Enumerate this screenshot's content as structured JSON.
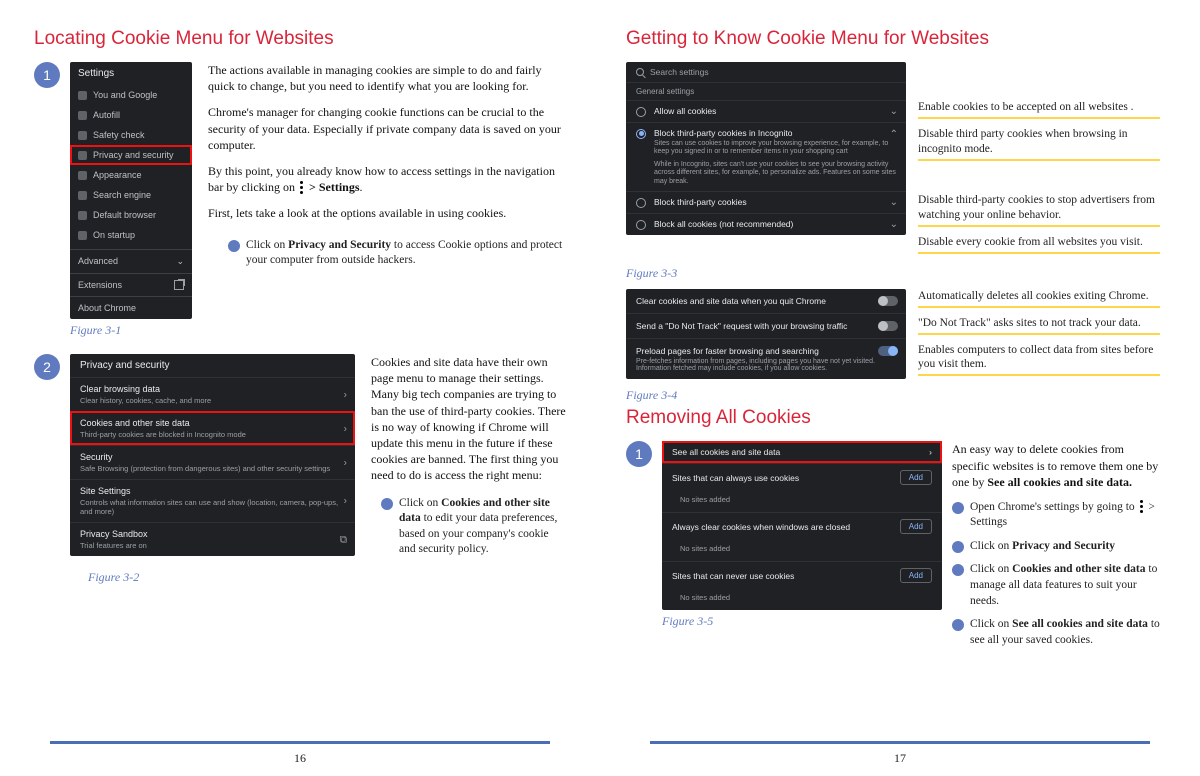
{
  "left": {
    "title": "Locating Cookie Menu for Websites",
    "para1": "The actions available in managing cookies are simple to do and fairly quick to change, but you need to identify what you are looking for.",
    "para2": "Chrome's manager for changing cookie functions can be crucial to the security of your data. Especially if private company data is saved on your computer.",
    "para3a": "By this point, you already know how to access settings in the navigation bar by clicking on",
    "para3b": "> Settings",
    "para4": "First, lets take a look at the options available in using cookies.",
    "bullet1_a": "Click on ",
    "bullet1_b": "Privacy and Security",
    "bullet1_c": " to access Cookie options and protect your computer from outside hackers.",
    "fig31": "Figure 3-1",
    "shot31": {
      "header": "Settings",
      "items": [
        "You and Google",
        "Autofill",
        "Safety check",
        "Privacy and security",
        "Appearance",
        "Search engine",
        "Default browser",
        "On startup"
      ],
      "advanced": "Advanced",
      "extensions": "Extensions",
      "about": "About Chrome"
    },
    "para5": "Cookies and site data have their own page menu to manage their settings. Many big tech companies are trying to ban the use of third-party cookies. There is no way of knowing if Chrome will update this menu in the future if these cookies are banned. The first thing you need to do is access the right menu:",
    "bullet2_a": "Click on ",
    "bullet2_b": "Cookies and other site data",
    "bullet2_c": " to edit your data preferences, based on your company's cookie and security policy.",
    "fig32": "Figure 3-2",
    "shot32": {
      "header": "Privacy and security",
      "opts": [
        {
          "t": "Clear browsing data",
          "s": "Clear history, cookies, cache, and more"
        },
        {
          "t": "Cookies and other site data",
          "s": "Third-party cookies are blocked in Incognito mode"
        },
        {
          "t": "Security",
          "s": "Safe Browsing (protection from dangerous sites) and other security settings"
        },
        {
          "t": "Site Settings",
          "s": "Controls what information sites can use and show (location, camera, pop-ups, and more)"
        },
        {
          "t": "Privacy Sandbox",
          "s": "Trial features are on"
        }
      ]
    },
    "pagenum": "16"
  },
  "right": {
    "title1": "Getting to Know Cookie Menu for Websites",
    "shot33": {
      "search": "Search settings",
      "gs": "General settings",
      "rows": [
        {
          "t": "Allow all cookies"
        },
        {
          "t": "Block third-party cookies in Incognito",
          "s1": "Sites can use cookies to improve your browsing experience, for example, to keep you signed in or to remember items in your shopping cart",
          "s2": "While in Incognito, sites can't use your cookies to see your browsing activity across different sites, for example, to personalize ads. Features on some sites may break."
        },
        {
          "t": "Block third-party cookies"
        },
        {
          "t": "Block all cookies (not recommended)"
        }
      ]
    },
    "annot33": [
      "Enable cookies to be accepted on all websites .",
      "Disable third party cookies when browsing in incognito mode.",
      "Disable third-party cookies to stop advertisers from watching your online behavior.",
      "Disable every cookie from all websites you visit."
    ],
    "fig33": "Figure 3-3",
    "shot34": {
      "rows": [
        {
          "t": "Clear cookies and site data when you quit Chrome",
          "on": false
        },
        {
          "t": "Send a \"Do Not Track\" request with your browsing traffic",
          "on": false
        },
        {
          "t": "Preload pages for faster browsing and searching",
          "s": "Pre-fetches information from pages, including pages you have not yet visited. Information fetched may include cookies, if you allow cookies.",
          "on": true
        }
      ]
    },
    "annot34": [
      "Automatically deletes all cookies exiting Chrome.",
      "\"Do Not Track\" asks sites to not track your data.",
      "Enables computers to collect data from sites before you visit them."
    ],
    "fig34": "Figure 3-4",
    "title2": "Removing All Cookies",
    "intro_a": "An easy way to delete cookies from specific websites is to remove them one by one by ",
    "intro_b": "See all cookies and site data.",
    "steps": [
      {
        "a": "Open Chrome's settings by going to ",
        "b": " > Settings"
      },
      {
        "a": "Click on ",
        "b": "Privacy and Security"
      },
      {
        "a": "Click on ",
        "b": "Cookies and other site data",
        "c": " to manage all data features to suit your needs."
      },
      {
        "a": "Click on ",
        "b": "See all cookies and site data",
        "c": " to see all your saved cookies."
      }
    ],
    "shot35": {
      "rows": [
        {
          "t": "See all cookies and site data",
          "arrow": true
        },
        {
          "t": "Sites that can always use cookies",
          "btn": "Add"
        },
        {
          "sub": "No sites added"
        },
        {
          "t": "Always clear cookies when windows are closed",
          "btn": "Add"
        },
        {
          "sub": "No sites added"
        },
        {
          "t": "Sites that can never use cookies",
          "btn": "Add"
        },
        {
          "sub": "No sites added"
        }
      ]
    },
    "fig35": "Figure 3-5",
    "pagenum": "17"
  }
}
